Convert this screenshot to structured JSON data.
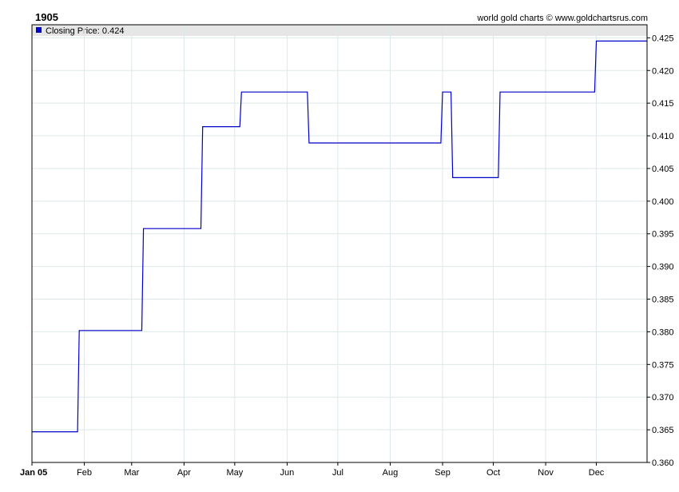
{
  "header": {
    "title": "1905",
    "credit": "world gold charts © www.goldchartsrus.com"
  },
  "legend": {
    "label": "Closing Price: 0.424",
    "swatch_color": "#0000cc"
  },
  "colors": {
    "line": "#0000cc",
    "grid": "#dde8e8",
    "legend_band": "#e6e6e6"
  },
  "chart_data": {
    "type": "line",
    "title": "1905",
    "step": true,
    "grid": true,
    "legend_position": "top-left",
    "ylim": [
      0.36,
      0.427
    ],
    "y_ticks": [
      0.36,
      0.365,
      0.37,
      0.375,
      0.38,
      0.385,
      0.39,
      0.395,
      0.4,
      0.405,
      0.41,
      0.415,
      0.42,
      0.425
    ],
    "y_tick_labels": [
      "0.360",
      "0.365",
      "0.370",
      "0.375",
      "0.380",
      "0.385",
      "0.390",
      "0.395",
      "0.400",
      "0.405",
      "0.410",
      "0.415",
      "0.420",
      "0.425"
    ],
    "xlim": [
      "1905-01-01",
      "1905-12-31"
    ],
    "x_ticks": [
      "1905-01-01",
      "1905-02-01",
      "1905-03-01",
      "1905-04-01",
      "1905-05-01",
      "1905-06-01",
      "1905-07-01",
      "1905-08-01",
      "1905-09-01",
      "1905-10-01",
      "1905-11-01",
      "1905-12-01"
    ],
    "x_tick_labels": [
      "Jan 05",
      "Feb",
      "Mar",
      "Apr",
      "May",
      "Jun",
      "Jul",
      "Aug",
      "Sep",
      "Oct",
      "Nov",
      "Dec"
    ],
    "series": [
      {
        "name": "Closing Price",
        "x": [
          "1905-01-01",
          "1905-01-28",
          "1905-01-29",
          "1905-03-07",
          "1905-03-08",
          "1905-04-11",
          "1905-04-12",
          "1905-05-04",
          "1905-05-05",
          "1905-06-13",
          "1905-06-14",
          "1905-08-31",
          "1905-09-01",
          "1905-09-06",
          "1905-09-07",
          "1905-10-04",
          "1905-10-05",
          "1905-11-30",
          "1905-12-01",
          "1905-12-31"
        ],
        "y": [
          0.3647,
          0.3647,
          0.3802,
          0.3802,
          0.3958,
          0.3958,
          0.4114,
          0.4114,
          0.4167,
          0.4167,
          0.4089,
          0.4089,
          0.4167,
          0.4167,
          0.4036,
          0.4036,
          0.4167,
          0.4167,
          0.4245,
          0.4245
        ]
      }
    ]
  }
}
